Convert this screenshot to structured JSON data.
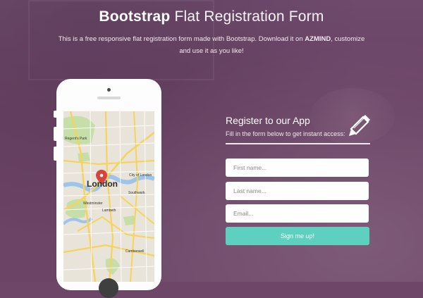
{
  "header": {
    "title_bold": "Bootstrap",
    "title_light": "Flat Registration Form"
  },
  "intro": {
    "line1_prefix": "This is a free responsive flat registration form made with Bootstrap. Download it on ",
    "brand": "AZMIND",
    "line1_suffix": ", customize",
    "line2": "and use it as you like!"
  },
  "map": {
    "city_label": "London",
    "labels": [
      "Regent's Park",
      "City of London",
      "Southwark",
      "Lambeth",
      "Camberwell",
      "Westminster"
    ]
  },
  "form": {
    "title": "Register to our App",
    "subtitle": "Fill in the form below to get instant access:",
    "first_name_placeholder": "First name...",
    "last_name_placeholder": "Last name...",
    "email_placeholder": "Email...",
    "submit_label": "Sign me up!"
  },
  "colors": {
    "background": "#6d4668",
    "accent_button": "#5dd0bf",
    "map_pin": "#d9443a"
  },
  "icons": {
    "form_icon": "pencil-icon",
    "map_marker": "map-pin-icon"
  }
}
